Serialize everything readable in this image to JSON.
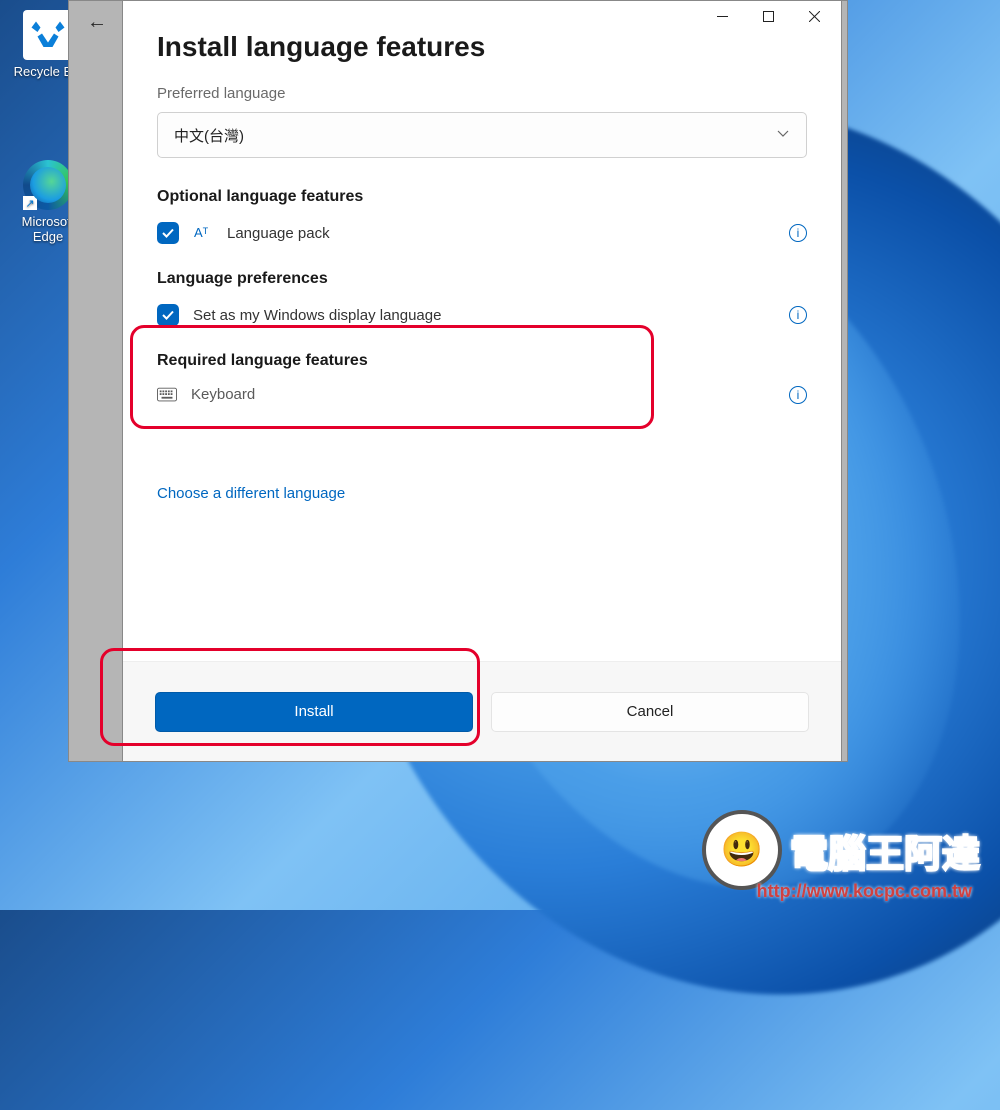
{
  "desktop": {
    "recycle_bin": "Recycle Bin",
    "edge": "Microsoft Edge"
  },
  "dialog": {
    "title": "Install language features",
    "preferred_label": "Preferred language",
    "selected_language": "中文(台灣)",
    "optional_header": "Optional language features",
    "language_pack": "Language pack",
    "prefs_header": "Language preferences",
    "set_display": "Set as my Windows display language",
    "required_header": "Required language features",
    "keyboard": "Keyboard",
    "choose_different": "Choose a different language",
    "install": "Install",
    "cancel": "Cancel"
  },
  "watermark": {
    "text": "電腦王阿達",
    "url": "http://www.kocpc.com.tw"
  }
}
